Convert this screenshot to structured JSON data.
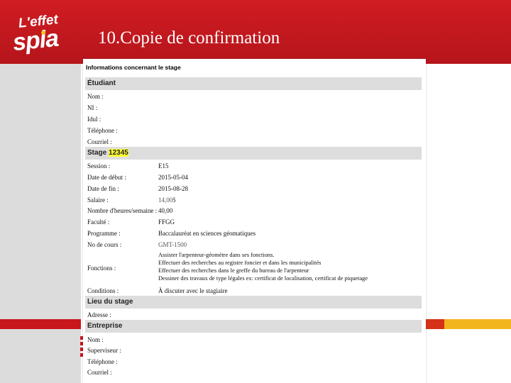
{
  "slide": {
    "title": "10.Copie de confirmation",
    "logo_top": "L'effet",
    "logo_bottom": "spla"
  },
  "form": {
    "title": "Informations concernant le stage",
    "sections": {
      "etudiant": {
        "heading": "Étudiant",
        "labels": [
          "Nom :",
          "NI :",
          "Idul :",
          "Téléphone :",
          "Courriel :"
        ]
      },
      "stage": {
        "heading_prefix": "Stage",
        "heading_number": "12345",
        "labels": [
          "Session :",
          "Date de début :",
          "Date de fin :",
          "Salaire :",
          "Nombre d'heures/semaine :",
          "Faculté :",
          "Programme :",
          "No de cours :",
          "Fonctions :",
          "Conditions :"
        ],
        "values": {
          "session": "E15",
          "date_debut": "2015-05-04",
          "date_fin": "2015-08-28",
          "salaire": "14,00$",
          "heures": "40,00",
          "faculte": "FFGG",
          "programme": "Baccalauréat en sciences géomatiques",
          "cours": "GMT-1500",
          "conditions": "À discuter avec le stagiaire"
        },
        "fonctions": [
          "Assister l'arpenteur-géomètre dans ses fonctions.",
          "Effectuer des recherches au registre foncier et dans les municipalités",
          "Effectuer des recherches dans le greffe du bureau de l'arpenteur",
          "Dessiner des travaux de type légales ex: certificat de localisation, certificat de piquetage"
        ]
      },
      "lieu": {
        "heading": "Lieu du stage",
        "labels": [
          "Adresse :"
        ]
      },
      "entreprise": {
        "heading": "Entreprise",
        "labels": [
          "Nom :",
          "Superviseur :",
          "Téléphone :",
          "Courriel :"
        ]
      }
    }
  },
  "colors": {
    "brand_red": "#c8161d",
    "accent_yellow": "#f2b51d",
    "highlight": "#ffff33",
    "section_bg": "#dddddd"
  }
}
